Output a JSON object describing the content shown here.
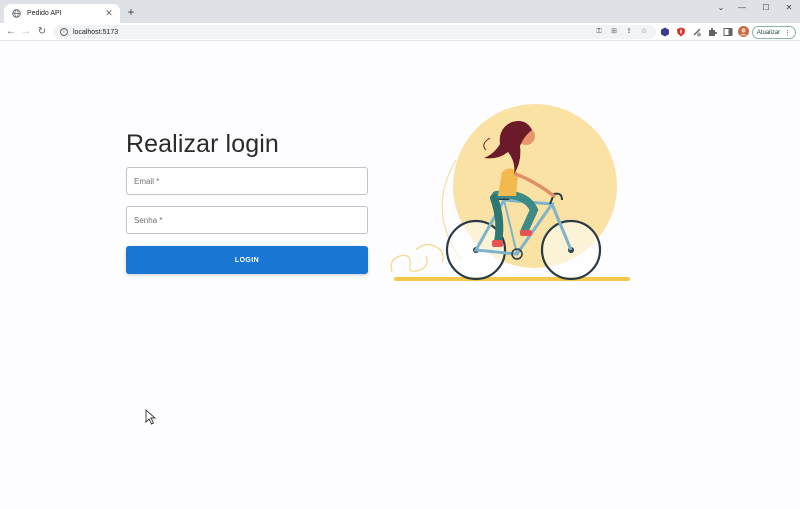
{
  "browser": {
    "tab_title": "Pedido API",
    "url": "localhost:5173",
    "update_label": "Atualizar",
    "window_controls": [
      "minimize",
      "maximize",
      "close"
    ],
    "icons": [
      "back-icon",
      "forward-icon",
      "reload-icon",
      "info-icon",
      "key-icon",
      "translate-icon",
      "share-icon",
      "star-icon",
      "extension-icon",
      "sidebar-icon",
      "profile-avatar"
    ]
  },
  "login": {
    "title": "Realizar login",
    "email_placeholder": "Email *",
    "password_placeholder": "Senha *",
    "button_label": "LOGIN"
  },
  "colors": {
    "primary": "#1976d2",
    "illustration_sun": "#f9e2a3",
    "illustration_ground": "#f5c84c"
  }
}
